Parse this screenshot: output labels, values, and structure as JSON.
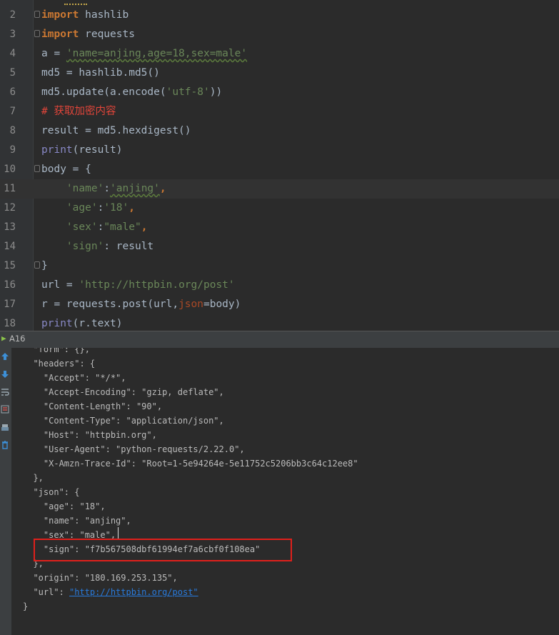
{
  "editor": {
    "lines": [
      {
        "num": "2",
        "parts": [
          {
            "t": "import",
            "c": "kw"
          },
          {
            "t": " hashlib",
            "c": ""
          }
        ]
      },
      {
        "num": "3",
        "parts": [
          {
            "t": "import",
            "c": "kw"
          },
          {
            "t": " requests",
            "c": ""
          }
        ]
      },
      {
        "num": "4",
        "parts": [
          {
            "t": "a = ",
            "c": ""
          },
          {
            "t": "'name=anjing,age=18,sex=male'",
            "c": "str"
          }
        ]
      },
      {
        "num": "5",
        "parts": [
          {
            "t": "md5 = hashlib.md5()",
            "c": ""
          }
        ]
      },
      {
        "num": "6",
        "parts": [
          {
            "t": "md5.update(a.encode(",
            "c": ""
          },
          {
            "t": "'utf-8'",
            "c": "str"
          },
          {
            "t": "))",
            "c": ""
          }
        ]
      },
      {
        "num": "7",
        "parts": [
          {
            "t": "# 获取加密内容",
            "c": "cm"
          }
        ]
      },
      {
        "num": "8",
        "parts": [
          {
            "t": "result = md5.hexdigest()",
            "c": ""
          }
        ]
      },
      {
        "num": "9",
        "parts": [
          {
            "t": "print",
            "c": "bi"
          },
          {
            "t": "(result)",
            "c": ""
          }
        ]
      },
      {
        "num": "10",
        "parts": [
          {
            "t": "body = {",
            "c": ""
          }
        ]
      },
      {
        "num": "11",
        "parts": [
          {
            "t": "    ",
            "c": ""
          },
          {
            "t": "'name'",
            "c": "str"
          },
          {
            "t": ":",
            "c": ""
          },
          {
            "t": "'anjing'",
            "c": "str"
          },
          {
            "t": ",",
            "c": "kw"
          }
        ]
      },
      {
        "num": "12",
        "parts": [
          {
            "t": "    ",
            "c": ""
          },
          {
            "t": "'age'",
            "c": "str"
          },
          {
            "t": ":",
            "c": ""
          },
          {
            "t": "'18'",
            "c": "str"
          },
          {
            "t": ",",
            "c": "kw"
          }
        ]
      },
      {
        "num": "13",
        "parts": [
          {
            "t": "    ",
            "c": ""
          },
          {
            "t": "'sex'",
            "c": "str"
          },
          {
            "t": ":",
            "c": ""
          },
          {
            "t": "\"male\"",
            "c": "str"
          },
          {
            "t": ",",
            "c": "kw"
          }
        ]
      },
      {
        "num": "14",
        "parts": [
          {
            "t": "    ",
            "c": ""
          },
          {
            "t": "'sign'",
            "c": "str"
          },
          {
            "t": ": result",
            "c": ""
          }
        ]
      },
      {
        "num": "15",
        "parts": [
          {
            "t": "}",
            "c": ""
          }
        ]
      },
      {
        "num": "16",
        "parts": [
          {
            "t": "url = ",
            "c": ""
          },
          {
            "t": "'http://httpbin.org/post'",
            "c": "str"
          }
        ]
      },
      {
        "num": "17",
        "parts": [
          {
            "t": "r = requests.post(url,",
            "c": ""
          },
          {
            "t": "json",
            "c": "prm"
          },
          {
            "t": "=body)",
            "c": ""
          }
        ]
      },
      {
        "num": "18",
        "parts": [
          {
            "t": "print",
            "c": "bi"
          },
          {
            "t": "(r.text)",
            "c": ""
          }
        ]
      }
    ]
  },
  "run_panel": {
    "title": "A16"
  },
  "console": {
    "lines": [
      "  \"form\": {},",
      "  \"headers\": {",
      "    \"Accept\": \"*/*\",",
      "    \"Accept-Encoding\": \"gzip, deflate\",",
      "    \"Content-Length\": \"90\",",
      "    \"Content-Type\": \"application/json\",",
      "    \"Host\": \"httpbin.org\",",
      "    \"User-Agent\": \"python-requests/2.22.0\",",
      "    \"X-Amzn-Trace-Id\": \"Root=1-5e94264e-5e11752c5206bb3c64c12ee8\"",
      "  },",
      "  \"json\": {",
      "    \"age\": \"18\",",
      "    \"name\": \"anjing\",",
      "    \"sex\": \"male\",",
      "    \"sign\": \"f7b567508dbf61994ef7a6cbf0f108ea\"",
      "  },",
      "  \"origin\": \"180.169.253.135\",",
      "  \"url\": ",
      "}"
    ],
    "url_link": "\"http://httpbin.org/post\""
  },
  "colors": {
    "background": "#2b2b2b",
    "keyword": "#cc7832",
    "string": "#6a8759",
    "comment": "#e0453a",
    "builtin": "#8888c6",
    "highlight_box": "#e0201b",
    "link": "#287bde"
  },
  "icons": [
    "fold-marker-icon",
    "run-icon",
    "scroll-up-icon",
    "scroll-down-icon",
    "soft-wrap-icon",
    "scroll-to-end-icon",
    "print-icon",
    "clear-all-icon"
  ]
}
